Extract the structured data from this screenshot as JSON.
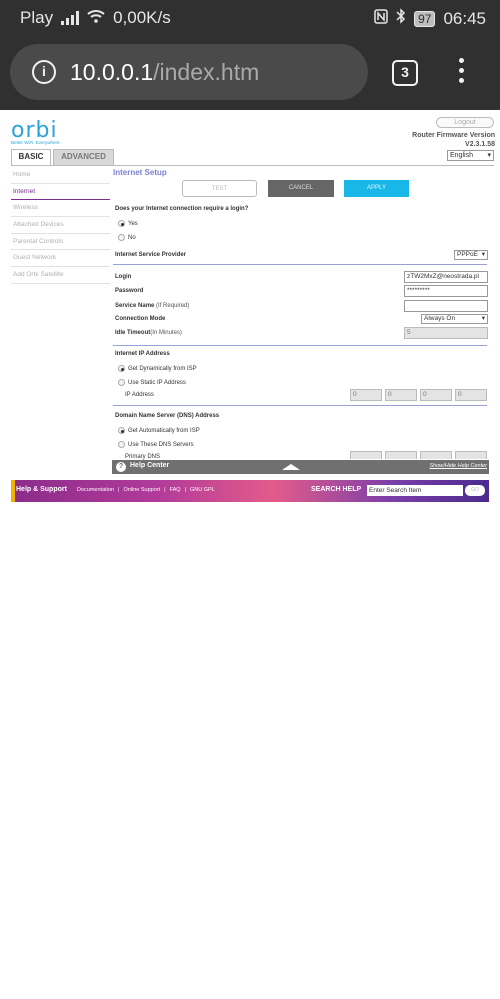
{
  "status_bar": {
    "carrier": "Play",
    "speed": "0,00K/s",
    "battery": "97",
    "time": "06:45",
    "icons": [
      "signal-icon",
      "wifi-icon",
      "nfc-icon",
      "bluetooth-icon",
      "battery-icon"
    ]
  },
  "browser": {
    "url_host": "10.0.0.1",
    "url_path": "/index.htm",
    "tab_count": "3",
    "icons": [
      "info-icon",
      "tabs-icon",
      "menu-icon"
    ]
  },
  "header": {
    "logo": "orbi",
    "tagline": "Better WiFi. Everywhere.",
    "logout": "Logout",
    "fw_label": "Router Firmware Version",
    "fw_version": "V2.3.1.58",
    "language": "English",
    "tabs": [
      {
        "label": "BASIC",
        "active": true
      },
      {
        "label": "ADVANCED",
        "active": false
      }
    ]
  },
  "sidebar": {
    "items": [
      {
        "label": "Home"
      },
      {
        "label": "Internet"
      },
      {
        "label": "Wireless"
      },
      {
        "label": "Attached Devices"
      },
      {
        "label": "Parental Controls"
      },
      {
        "label": "Guest Network"
      },
      {
        "label": "Add Orbi Satellite"
      }
    ],
    "active_index": 1
  },
  "main": {
    "title": "Internet Setup",
    "buttons": {
      "test": "TEST",
      "cancel": "CANCEL",
      "apply": "APPLY"
    },
    "login_question": "Does your Internet connection require a login?",
    "login_yes": "Yes",
    "login_no": "No",
    "isp_label": "Internet Service Provider",
    "isp_value": "PPPoE",
    "login_label": "Login",
    "login_value": "zTW2MxZ@neostrada.pl",
    "password_label": "Password",
    "password_value": "*********",
    "service_label": "Service Name",
    "service_note": "(If Required)",
    "service_value": "",
    "conn_mode_label": "Connection Mode",
    "conn_mode_value": "Always On",
    "idle_label": "Idle Timeout",
    "idle_note": "(In Minutes)",
    "idle_value": "5",
    "ip_section": "Internet IP Address",
    "ip_dynamic": "Get Dynamically from ISP",
    "ip_static": "Use Static IP Address",
    "ip_address_label": "IP Address",
    "ip_octets": [
      "0",
      "0",
      "0",
      "0"
    ],
    "dns_section": "Domain Name Server (DNS) Address",
    "dns_auto": "Get Automatically from ISP",
    "dns_use": "Use These DNS Servers",
    "primary_dns_label": "Primary DNS"
  },
  "help_bar": {
    "icon": "help-circle-icon",
    "title": "Help Center",
    "toggle": "Show/Hide Help Center"
  },
  "footer": {
    "brand": "Help & Support",
    "links": [
      "Documentation",
      "Online Support",
      "FAQ",
      "GNU GPL"
    ],
    "search_label": "SEARCH HELP",
    "search_placeholder": "Enter Search Item",
    "go_label": "GO"
  }
}
